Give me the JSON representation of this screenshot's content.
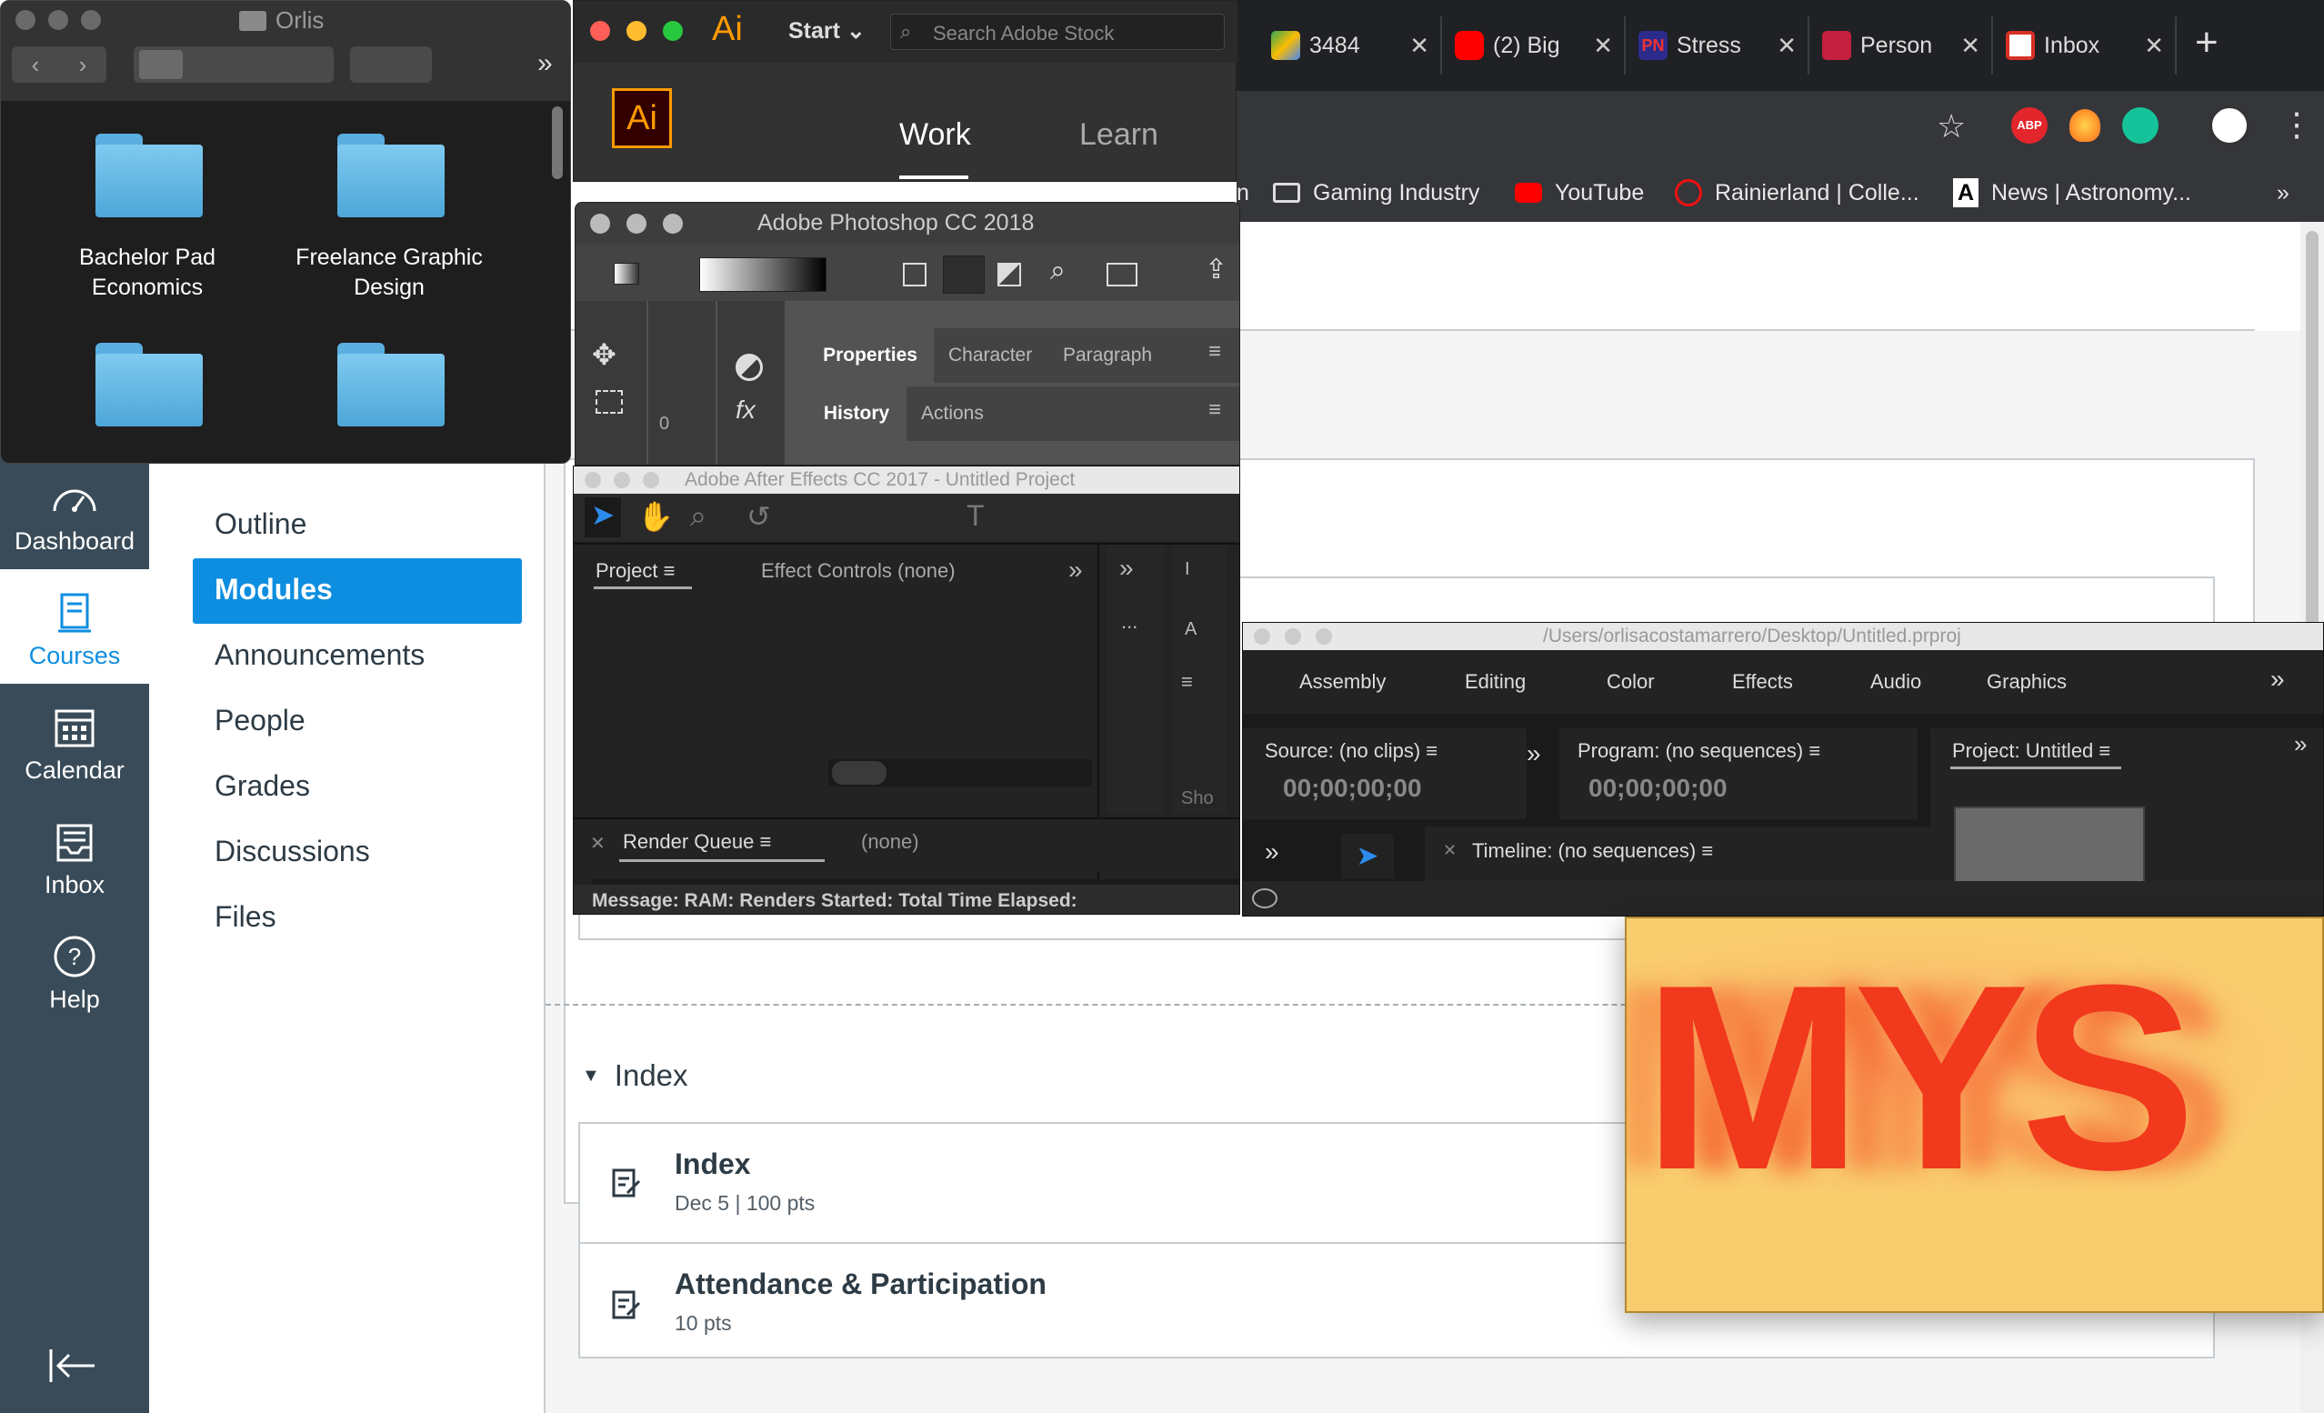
{
  "finder": {
    "title": "Orlis",
    "folders": [
      "Bachelor Pad\nEconomics",
      "Freelance Graphic\nDesign"
    ]
  },
  "illustrator": {
    "logo": "Ai",
    "start_label": "Start",
    "search_placeholder": "Search Adobe Stock",
    "tabs": [
      "Work",
      "Learn"
    ]
  },
  "photoshop": {
    "title": "Adobe Photoshop CC 2018",
    "panel_tabs": [
      "Properties",
      "Character",
      "Paragraph"
    ],
    "panel_tabs2": [
      "History",
      "Actions"
    ],
    "zero": "0"
  },
  "after_effects": {
    "title": "Adobe After Effects CC 2017 - Untitled Project",
    "project_tab": "Project",
    "effect_controls": "Effect Controls (none)",
    "render_queue": "Render Queue",
    "render_value": "(none)",
    "message": "Message: RAM: Renders Started: Total Time Elapsed:",
    "side_i": "I",
    "side_a": "A",
    "side_dots": "...",
    "side_sho": "Sho"
  },
  "premiere": {
    "title": "/Users/orlisacostamarrero/Desktop/Untitled.prproj",
    "workspaces": [
      "Assembly",
      "Editing",
      "Color",
      "Effects",
      "Audio",
      "Graphics"
    ],
    "source": "Source: (no clips)",
    "source_tc": "00;00;00;00",
    "program": "Program: (no sequences)",
    "program_tc": "00;00;00;00",
    "project": "Project: Untitled",
    "timeline": "Timeline: (no sequences)"
  },
  "chrome": {
    "tabs": [
      "3484",
      "(2) Big",
      "Stress",
      "Person",
      "Inbox"
    ],
    "new_tab": "+",
    "bookmarks": [
      "Gaming Industry",
      "YouTube",
      "Rainierland | Colle...",
      "News | Astronomy..."
    ],
    "bookmark_partial": "n",
    "more": "»",
    "abp": "ABP"
  },
  "lms": {
    "global_nav": [
      "Dashboard",
      "Courses",
      "Calendar",
      "Inbox",
      "Help"
    ],
    "course_nav": [
      "Outline",
      "Modules",
      "Announcements",
      "People",
      "Grades",
      "Discussions",
      "Files"
    ],
    "module_title": "Index",
    "items": [
      {
        "title": "Index",
        "meta": "Dec 5  |  100 pts"
      },
      {
        "title": "Attendance & Participation",
        "meta": "10 pts"
      }
    ]
  },
  "preview": {
    "text": "MYS"
  },
  "colors": {
    "canvas_nav": "#394b58",
    "canvas_active": "#0e8ee0",
    "chrome_bg": "#202124"
  }
}
